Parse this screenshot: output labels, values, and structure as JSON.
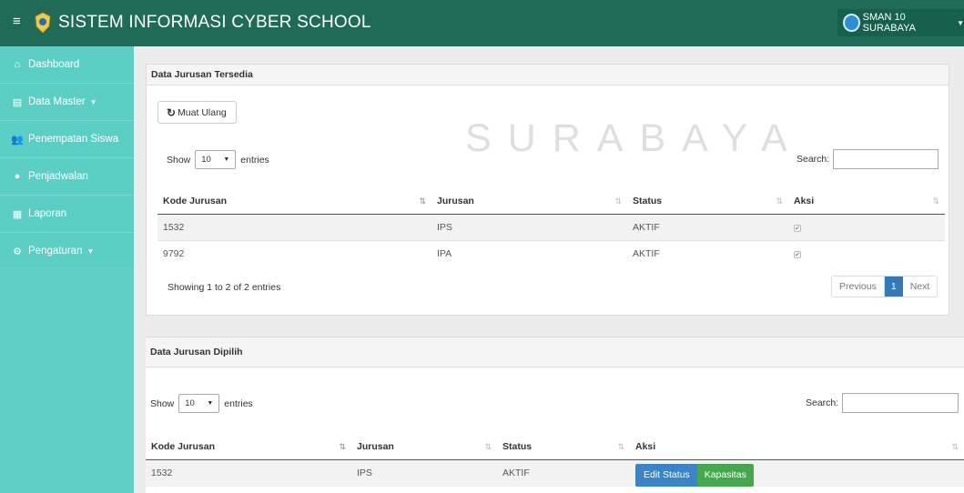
{
  "app": {
    "title": "SISTEM INFORMASI CYBER SCHOOL",
    "user_label": "SMAN 10 SURABAYA",
    "watermark": "SURABAYA",
    "colors": {
      "header": "#1f6b57",
      "sidebar": "#5ccfc4",
      "primary": "#337ab7",
      "success": "#46a84d"
    }
  },
  "sidebar": {
    "items": [
      {
        "label": "Dashboard",
        "icon": "home-icon"
      },
      {
        "label": "Data Master",
        "icon": "list-icon",
        "dropdown": true
      },
      {
        "label": "Penempatan Siswa",
        "icon": "users-icon"
      },
      {
        "label": "Penjadwalan",
        "icon": "clock-icon"
      },
      {
        "label": "Laporan",
        "icon": "document-icon"
      },
      {
        "label": "Pengaturan",
        "icon": "gear-icon",
        "dropdown": true
      }
    ]
  },
  "panel1": {
    "title": "Data Jurusan Tersedia",
    "reload_label": "Muat Ulang",
    "show_label": "Show",
    "entries_value": "10",
    "entries_label": "entries",
    "search_label": "Search:",
    "columns": [
      "Kode Jurusan",
      "Jurusan",
      "Status",
      "Aksi"
    ],
    "rows": [
      {
        "kode": "1532",
        "jurusan": "IPS",
        "status": "AKTIF",
        "checked": "✔"
      },
      {
        "kode": "9792",
        "jurusan": "IPA",
        "status": "AKTIF",
        "checked": "✔"
      }
    ],
    "info": "Showing 1 to 2 of 2 entries",
    "pager": {
      "previous": "Previous",
      "page": "1",
      "next": "Next"
    }
  },
  "panel2": {
    "title": "Data Jurusan Dipilih",
    "show_label": "Show",
    "entries_value": "10",
    "entries_label": "entries",
    "search_label": "Search:",
    "columns": [
      "Kode Jurusan",
      "Jurusan",
      "Status",
      "Aksi"
    ],
    "rows": [
      {
        "kode": "1532",
        "jurusan": "IPS",
        "status": "AKTIF",
        "edit_label": "Edit Status",
        "kapasitas_label": "Kapasitas"
      }
    ]
  }
}
